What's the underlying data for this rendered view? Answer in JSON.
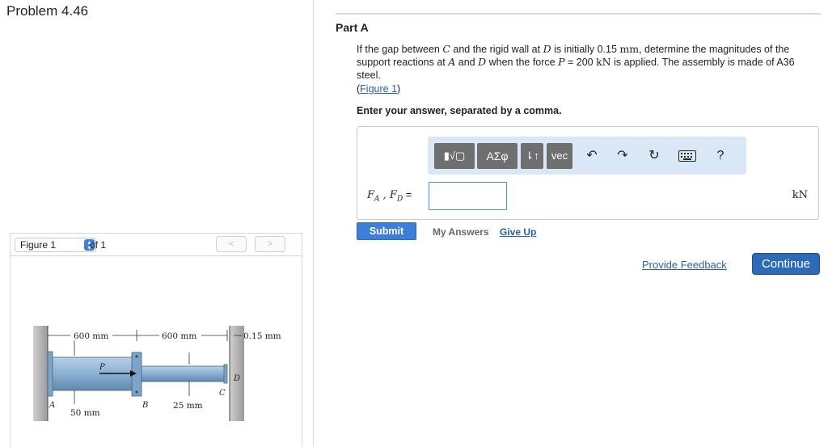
{
  "problem": {
    "title": "Problem 4.46"
  },
  "part": {
    "title": "Part A"
  },
  "question": {
    "pre_c": "If the gap between ",
    "var_c": "C",
    "pre_d": " and the rigid wall at ",
    "var_d": "D",
    "pre_gap": " is initially 0.15 ",
    "unit_mm": "mm",
    "pre_a": ", determine the magnitudes of the support reactions at ",
    "var_a": "A",
    "and_text": " and ",
    "var_d2": "D",
    "pre_p": " when the force ",
    "var_p": "P",
    "force_value": " = 200 ",
    "unit_kn": "kN",
    "post": " is applied. The assembly is made of A36 steel.",
    "figure_link_open": "(",
    "figure_link_text": "Figure 1",
    "figure_link_close": ")",
    "instruction": "Enter your answer, separated by a comma."
  },
  "toolbar": {
    "templates_label": "▮√▢",
    "greek_label": "ΑΣφ",
    "arrows_label": "⇂↑",
    "vec_label": "vec",
    "undo_icon": "undo-icon",
    "redo_icon": "redo-icon",
    "reset_icon": "reset-icon",
    "keyboard_icon": "keyboard-icon",
    "help_label": "?"
  },
  "answer": {
    "prefix": "F",
    "prefix_sub_a": "A",
    "prefix_sep": " , F",
    "prefix_sub_d": "D",
    "prefix_eq": " =",
    "value": "",
    "unit": "kN"
  },
  "actions": {
    "submit": "Submit",
    "my_answers": "My Answers",
    "give_up": "Give Up",
    "provide_feedback": "Provide Feedback",
    "continue": "Continue"
  },
  "figure": {
    "select_value": "Figure 1",
    "of_text": "of 1",
    "prev": "<",
    "next": ">",
    "dim_600_left": "600 mm",
    "dim_600_right": "600 mm",
    "dim_gap": "0.15 mm",
    "dim_50": "50 mm",
    "dim_25": "25 mm",
    "label_p": "P",
    "label_a": "A",
    "label_b": "B",
    "label_c": "C",
    "label_d": "D"
  },
  "colors": {
    "accent": "#3b7fd8",
    "continue": "#2d6ab7",
    "link": "#2a5fa8",
    "toolbar_bg": "#d9e7f7",
    "rod": "#8fb4d6"
  }
}
